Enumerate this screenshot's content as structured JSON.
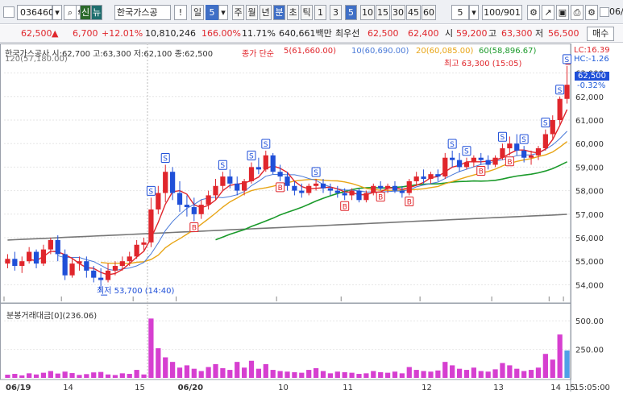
{
  "toolbar": {
    "code": "036460",
    "fav_icon": "신",
    "news_icon": "뉴",
    "stock_name": "한국가스공",
    "excl": "!",
    "day_label": "일",
    "count_val": "5",
    "periods": [
      "주",
      "월",
      "년",
      "분",
      "초",
      "틱",
      "1",
      "3",
      "5",
      "10",
      "15",
      "30",
      "45",
      "60"
    ],
    "active_period": "5",
    "interval_val": "5",
    "range": "100/901",
    "right_val": "06/"
  },
  "info": {
    "price": "62,500",
    "up_mark": "▲",
    "change": "6,700",
    "rate": "+12.01%",
    "volume": "10,810,246",
    "vol_ratio": "166.00%",
    "turnover": "11.71%",
    "amount": "640,661백만",
    "pref_label": "최우선",
    "ask": "62,500",
    "bid": "62,400",
    "low_label": "시",
    "open": "59,200",
    "high_label": "고",
    "high": "63,300",
    "lo_label": "저",
    "low": "56,500",
    "trade_btn": "매수"
  },
  "legend": {
    "stock": "한국가스공사 시:62,700 고:63,300 저:62,100 종:62,500",
    "ma_label": "종가 단순",
    "ma5": "5(61,660.00)",
    "ma10": "10(60,690.00)",
    "ma20": "20(60,085.00)",
    "ma60": "60(58,896.67)",
    "ma120": "120(57,180.00)",
    "lc": "LC:16.39",
    "hc": "HC:-1.26",
    "last_price": "62,500",
    "last_pct": "-0.32%",
    "max_note": "최고 63,300 (15:05)",
    "min_note": "최저 53,700 (14:40)",
    "volume_title": "분봉거래대금[0](236.06)"
  },
  "colors": {
    "up": "#e0262c",
    "down": "#1f4fd8",
    "ma5": "#e0262c",
    "ma10": "#4a7ad8",
    "ma20": "#e8a516",
    "ma60": "#1a9a2a",
    "ma120": "#777777",
    "vol": "#d63fd0"
  },
  "chart_data": {
    "type": "candlestick",
    "price_axis": [
      "63,000",
      "62,000",
      "61,000",
      "60,000",
      "59,000",
      "58,000",
      "57,000",
      "56,000",
      "55,000",
      "54,000"
    ],
    "volume_axis": [
      "500.00",
      "250.00"
    ],
    "time_axis": [
      "06/19",
      "14",
      "15",
      "06/20",
      "10",
      "11",
      "12",
      "13",
      "14",
      "15",
      "15:05:00"
    ],
    "price_range": [
      53500,
      63500
    ],
    "volume_range": [
      0,
      600
    ],
    "candles": [
      [
        54.9,
        55.3,
        54.7,
        55.1
      ],
      [
        55.1,
        55.4,
        54.6,
        54.8
      ],
      [
        54.8,
        55.2,
        54.5,
        55.0
      ],
      [
        55.0,
        55.6,
        54.9,
        55.4
      ],
      [
        55.4,
        55.5,
        54.7,
        54.9
      ],
      [
        54.9,
        55.7,
        54.8,
        55.5
      ],
      [
        55.5,
        56.0,
        55.3,
        55.9
      ],
      [
        55.9,
        56.1,
        55.0,
        55.3
      ],
      [
        55.3,
        55.5,
        54.2,
        54.4
      ],
      [
        54.4,
        55.1,
        54.3,
        54.9
      ],
      [
        54.9,
        55.2,
        54.6,
        55.0
      ],
      [
        55.0,
        55.2,
        54.3,
        54.6
      ],
      [
        54.6,
        54.8,
        54.1,
        54.3
      ],
      [
        54.3,
        54.7,
        53.7,
        54.2
      ],
      [
        54.2,
        54.9,
        54.1,
        54.6
      ],
      [
        54.6,
        55.0,
        54.4,
        54.8
      ],
      [
        54.8,
        55.2,
        54.6,
        55.0
      ],
      [
        55.0,
        55.4,
        54.8,
        55.2
      ],
      [
        55.2,
        55.9,
        55.1,
        55.7
      ],
      [
        55.7,
        56.0,
        55.4,
        55.8
      ],
      [
        55.8,
        57.7,
        55.6,
        57.2
      ],
      [
        57.2,
        58.2,
        57.0,
        57.9
      ],
      [
        57.9,
        59.1,
        57.5,
        58.8
      ],
      [
        58.8,
        59.0,
        57.6,
        57.9
      ],
      [
        57.9,
        58.4,
        57.1,
        57.4
      ],
      [
        57.4,
        57.8,
        56.9,
        57.3
      ],
      [
        57.3,
        57.7,
        56.7,
        57.0
      ],
      [
        57.0,
        57.6,
        56.8,
        57.4
      ],
      [
        57.4,
        58.0,
        57.2,
        57.8
      ],
      [
        57.8,
        58.5,
        57.6,
        58.2
      ],
      [
        58.2,
        58.8,
        58.0,
        58.6
      ],
      [
        58.6,
        58.9,
        58.1,
        58.3
      ],
      [
        58.3,
        58.6,
        57.8,
        58.0
      ],
      [
        58.0,
        58.5,
        57.8,
        58.4
      ],
      [
        58.4,
        59.2,
        58.3,
        59.0
      ],
      [
        59.0,
        59.4,
        58.7,
        58.9
      ],
      [
        58.9,
        59.7,
        58.8,
        59.5
      ],
      [
        59.5,
        59.6,
        58.7,
        58.8
      ],
      [
        58.8,
        59.1,
        58.4,
        58.6
      ],
      [
        58.6,
        58.8,
        58.0,
        58.2
      ],
      [
        58.2,
        58.4,
        57.8,
        58.0
      ],
      [
        58.0,
        58.3,
        57.7,
        57.9
      ],
      [
        57.9,
        58.3,
        57.8,
        58.2
      ],
      [
        58.2,
        58.5,
        58.0,
        58.3
      ],
      [
        58.3,
        58.5,
        57.9,
        58.1
      ],
      [
        58.1,
        58.3,
        57.8,
        58.0
      ],
      [
        58.0,
        58.2,
        57.7,
        57.9
      ],
      [
        57.9,
        58.1,
        57.6,
        57.8
      ],
      [
        57.8,
        58.1,
        57.6,
        58.0
      ],
      [
        58.0,
        58.1,
        57.5,
        57.6
      ],
      [
        57.6,
        58.0,
        57.5,
        57.9
      ],
      [
        57.9,
        58.3,
        57.8,
        58.2
      ],
      [
        58.2,
        58.4,
        58.0,
        58.1
      ],
      [
        58.1,
        58.3,
        57.9,
        58.2
      ],
      [
        58.2,
        58.4,
        57.9,
        58.0
      ],
      [
        58.0,
        58.2,
        57.7,
        57.9
      ],
      [
        57.9,
        58.5,
        57.8,
        58.4
      ],
      [
        58.4,
        58.8,
        58.2,
        58.6
      ],
      [
        58.6,
        58.9,
        58.3,
        58.5
      ],
      [
        58.5,
        58.8,
        58.3,
        58.7
      ],
      [
        58.7,
        58.9,
        58.4,
        58.6
      ],
      [
        58.6,
        59.6,
        58.5,
        59.4
      ],
      [
        59.4,
        59.7,
        59.0,
        59.3
      ],
      [
        59.3,
        59.6,
        58.8,
        59.0
      ],
      [
        59.0,
        59.4,
        58.9,
        59.2
      ],
      [
        59.2,
        59.5,
        59.0,
        59.4
      ],
      [
        59.4,
        59.6,
        59.1,
        59.3
      ],
      [
        59.3,
        59.5,
        58.9,
        59.1
      ],
      [
        59.1,
        59.5,
        59.0,
        59.4
      ],
      [
        59.4,
        60.0,
        59.3,
        59.8
      ],
      [
        59.8,
        60.3,
        59.5,
        60.0
      ],
      [
        60.0,
        60.4,
        59.5,
        59.7
      ],
      [
        59.7,
        59.9,
        59.2,
        59.4
      ],
      [
        59.4,
        59.7,
        59.1,
        59.5
      ],
      [
        59.5,
        59.9,
        59.3,
        59.8
      ],
      [
        59.8,
        60.6,
        59.7,
        60.4
      ],
      [
        60.4,
        61.2,
        60.2,
        61.0
      ],
      [
        61.0,
        62.0,
        60.8,
        61.9
      ],
      [
        61.9,
        63.3,
        61.7,
        62.5
      ]
    ],
    "volumes": [
      28,
      35,
      22,
      40,
      30,
      45,
      60,
      38,
      55,
      42,
      26,
      33,
      48,
      52,
      30,
      25,
      40,
      35,
      70,
      30,
      520,
      260,
      180,
      140,
      90,
      110,
      80,
      60,
      95,
      120,
      85,
      70,
      140,
      90,
      150,
      80,
      120,
      70,
      60,
      55,
      50,
      45,
      70,
      85,
      60,
      40,
      55,
      50,
      45,
      35,
      40,
      60,
      50,
      45,
      55,
      40,
      95,
      70,
      60,
      55,
      65,
      140,
      110,
      80,
      70,
      90,
      60,
      55,
      75,
      130,
      110,
      80,
      60,
      70,
      90,
      210,
      160,
      380,
      240
    ]
  }
}
